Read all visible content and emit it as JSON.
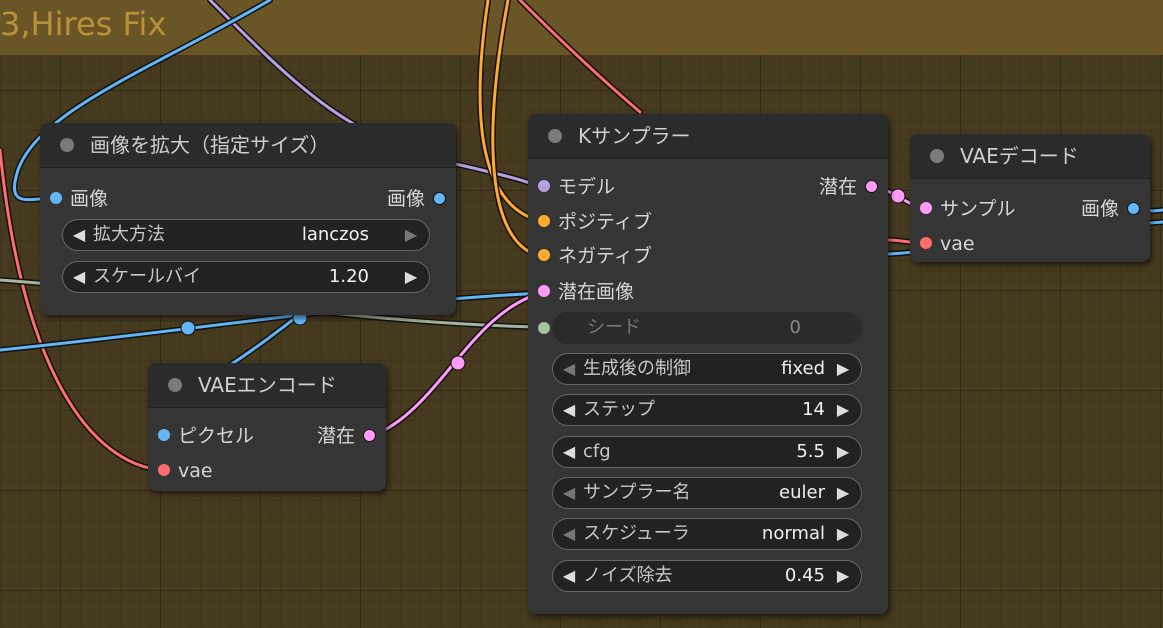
{
  "group": {
    "title": "3,Hires Fix"
  },
  "colors": {
    "model": "#b7a0e0",
    "conditioning": "#ffa931",
    "latent": "#ff9cf9",
    "image": "#64b5f6",
    "vae": "#ff6e6e",
    "int": "#a1c49b",
    "grey_wire": "#a8b4a0"
  },
  "nodes": {
    "upscale": {
      "title": "画像を拡大（指定サイズ）",
      "input_image": "画像",
      "output_image": "画像",
      "widgets": [
        {
          "label": "拡大方法",
          "value": "lanczos"
        },
        {
          "label": "スケールバイ",
          "value": "1.20"
        }
      ]
    },
    "ksampler": {
      "title": "Kサンプラー",
      "inputs": [
        "モデル",
        "ポジティブ",
        "ネガティブ",
        "潜在画像"
      ],
      "output_latent": "潜在",
      "seed": {
        "label": "シード",
        "value": "0"
      },
      "widgets": [
        {
          "label": "生成後の制御",
          "value": "fixed"
        },
        {
          "label": "ステップ",
          "value": "14"
        },
        {
          "label": "cfg",
          "value": "5.5"
        },
        {
          "label": "サンプラー名",
          "value": "euler"
        },
        {
          "label": "スケジューラ",
          "value": "normal"
        },
        {
          "label": "ノイズ除去",
          "value": "0.45"
        }
      ]
    },
    "vae_encode": {
      "title": "VAEエンコード",
      "input_pixels": "ピクセル",
      "input_vae": "vae",
      "output_latent": "潜在"
    },
    "vae_decode": {
      "title": "VAEデコード",
      "input_samples": "サンプル",
      "input_vae": "vae",
      "output_image": "画像"
    }
  }
}
